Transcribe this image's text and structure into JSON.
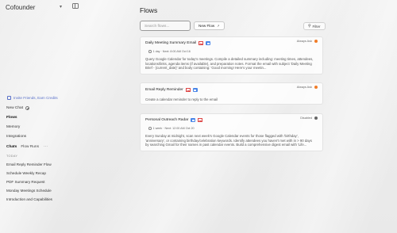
{
  "app": {
    "brand": "Cofounder"
  },
  "sidebar": {
    "invite_label": "Invite Friends, Earn Credits",
    "new_chat_label": "New Chat",
    "items": [
      {
        "label": "Flows"
      },
      {
        "label": "Memory"
      },
      {
        "label": "Integrations"
      }
    ],
    "chat_tabs": {
      "chats": "Chats",
      "flow_runs": "Flow Runs",
      "more": "···"
    },
    "section_label": "TODAY",
    "history": [
      "Email Reply Reminder Flow",
      "Schedule Weekly Recap",
      "PDF Summary Request",
      "Monday Meetings Schedule",
      "Introduction and Capabilities"
    ]
  },
  "main": {
    "title": "Flows",
    "search": {
      "placeholder": "Search flows..."
    },
    "new_flow_label": "New Flow",
    "filter_label": "Filter",
    "flows": [
      {
        "title": "Daily Meeting Summary Email",
        "icons": [
          "gmail-icon",
          "google-calendar-icon"
        ],
        "schedule": "1 day · Next: 8:00 AM Oct 16",
        "status": "Always Ask",
        "status_color": "#f07c28",
        "description": "Query Google Calendar for today's meetings. Compile a detailed summary including: meeting times, attendees, locations/links, agenda items (if available), and preparation notes. Format the email with subject 'Daily Meeting Brief - {current_date}' and body containing: 'Good morning! Here's your meetin..."
      },
      {
        "title": "Email Reply Reminder",
        "icons": [
          "gmail-icon",
          "google-calendar-icon"
        ],
        "schedule": "",
        "status": "Always Ask",
        "status_color": "#f07c28",
        "description": "Create a calendar reminder to reply to the email"
      },
      {
        "title": "Personal Outreach Radar",
        "icons": [
          "google-calendar-icon",
          "gmail-icon"
        ],
        "schedule": "1 week · Next: 12:00 AM Oct 20",
        "status": "Disabled",
        "status_color": "#666666",
        "description": "Every Sunday at midnight, scan next week's Google Calendar events for those flagged with 'birthday', 'anniversary', or containing birthday/celebration keywords. Identify attendees you haven't met with in > 90 days by searching Gmail for their names in past calendar events. Build a comprehensive digest email with 'Life..."
      }
    ]
  }
}
